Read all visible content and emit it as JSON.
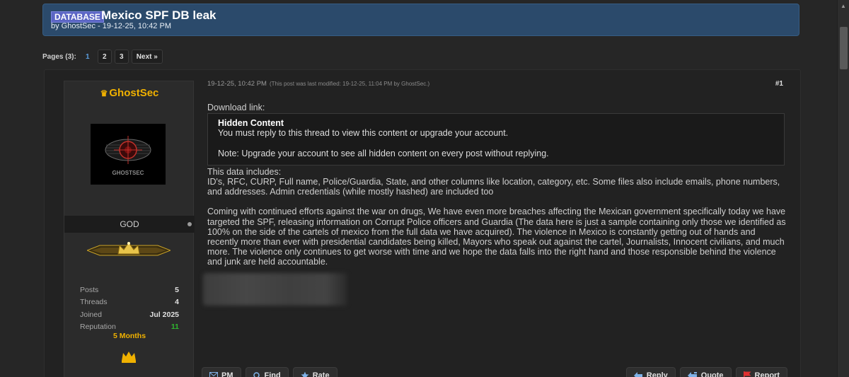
{
  "thread": {
    "prefix": "DATABASE",
    "title": "Mexico SPF DB leak",
    "byline": "by GhostSec - 19-12-25, 10:42 PM"
  },
  "pagination": {
    "label": "Pages (3):",
    "pages": [
      "1",
      "2",
      "3"
    ],
    "current": "1",
    "next": "Next »"
  },
  "author": {
    "username": "GhostSec",
    "avatar_text": "GHOSTSEC",
    "usertitle": "GOD",
    "stats": [
      {
        "label": "Posts",
        "value": "5"
      },
      {
        "label": "Threads",
        "value": "4"
      },
      {
        "label": "Joined",
        "value": "Jul 2025"
      },
      {
        "label": "Reputation",
        "value": "11"
      }
    ],
    "membership": "5 Months",
    "colors": {
      "username": "#f0b100",
      "reputation": "#2fb52f"
    }
  },
  "post": {
    "date": "19-12-25, 10:42 PM",
    "edited": "(This post was last modified: 19-12-25, 11:04 PM by GhostSec.)",
    "number": "#1",
    "download_label": "Download link:",
    "hidden_title": "Hidden Content",
    "hidden_text": "You must reply to this thread to view this content or upgrade your account.",
    "hidden_note": "Note: Upgrade your account to see all hidden content on every post without replying.",
    "includes_heading": "This data includes:",
    "includes_text": "ID's, RFC, CURP, Full name, Police/Guardia, State, and other columns like location, category, etc. Some files also include emails, phone numbers, and addresses. Admin credentials (while mostly hashed) are included too",
    "body_text": "Coming with continued efforts against the war on drugs, We have even more breaches affecting the Mexican government specifically today we have targeted the SPF, releasing information on Corrupt Police officers and Guardia (The data here is just a sample containing only those we identified as 100% on the side of the cartels of mexico from the full data we have acquired). The violence in Mexico is constantly getting out of hands and recently more than ever with presidential candidates being killed, Mayors who speak out against the cartel, Journalists, Innocent civilians, and much more. The violence only continues to get worse with time and we hope the data falls into the right hand and those responsible behind the violence and junk are held accountable."
  },
  "buttons": {
    "pm": "PM",
    "find": "Find",
    "rate": "Rate",
    "reply": "Reply",
    "quote": "Quote",
    "report": "Report"
  },
  "icons": [
    "mail-icon",
    "search-icon",
    "star-icon",
    "reply-icon",
    "quote-icon",
    "flag-icon",
    "crown-icon"
  ]
}
